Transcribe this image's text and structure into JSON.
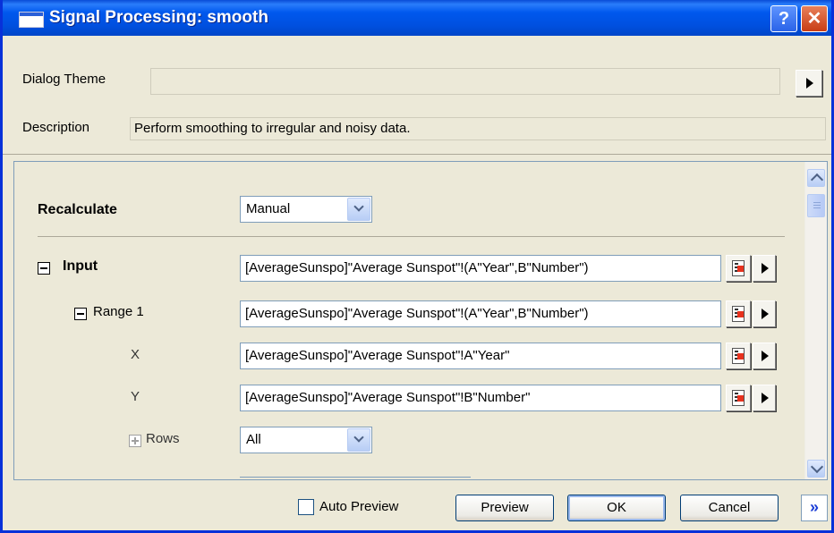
{
  "window": {
    "title": "Signal Processing: smooth",
    "help_label": "?",
    "close_label": "✕"
  },
  "theme": {
    "label": "Dialog Theme",
    "value": ""
  },
  "description": {
    "label": "Description",
    "value": "Perform smoothing to irregular and noisy data."
  },
  "recalculate": {
    "label": "Recalculate",
    "value": "Manual"
  },
  "input": {
    "label": "Input",
    "value": "[AverageSunspo]\"Average Sunspot\"!(A\"Year\",B\"Number\")"
  },
  "range1": {
    "label": "Range 1",
    "value": "[AverageSunspo]\"Average Sunspot\"!(A\"Year\",B\"Number\")"
  },
  "x": {
    "label": "X",
    "value": "[AverageSunspo]\"Average Sunspot\"!A\"Year\""
  },
  "y": {
    "label": "Y",
    "value": "[AverageSunspo]\"Average Sunspot\"!B\"Number\""
  },
  "rows": {
    "label": "Rows",
    "value": "All"
  },
  "footer": {
    "auto_preview_label": "Auto Preview",
    "auto_preview_checked": false,
    "preview_label": "Preview",
    "ok_label": "OK",
    "cancel_label": "Cancel",
    "more_label": "»"
  },
  "colors": {
    "titlebar": "#0058ee",
    "dialog_bg": "#ece9d8",
    "close": "#c83d15"
  }
}
